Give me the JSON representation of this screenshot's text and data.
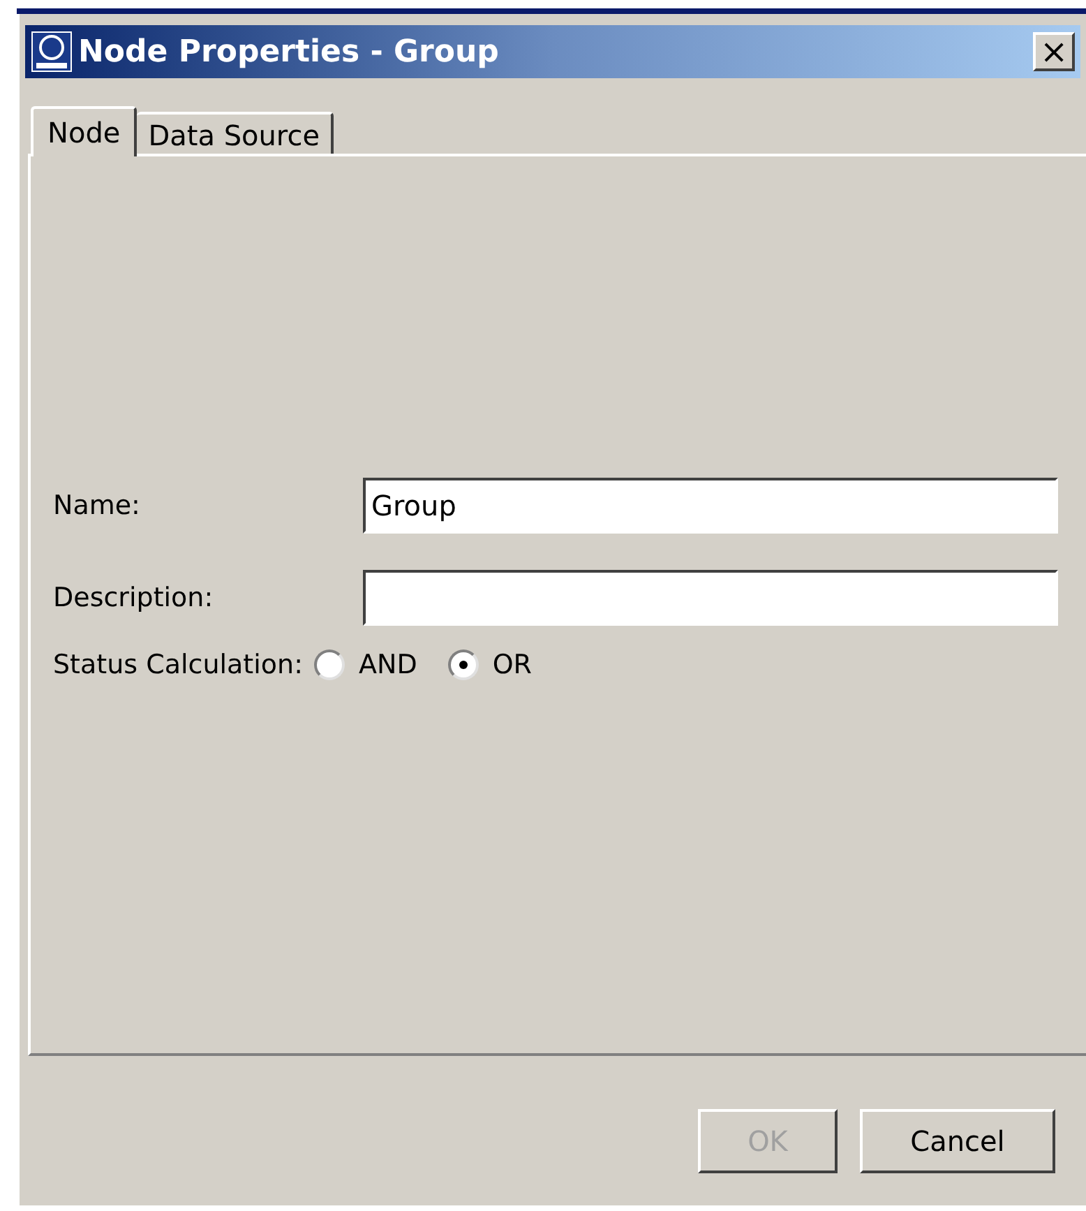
{
  "window": {
    "title": "Node Properties - Group",
    "close": "×"
  },
  "tabs": [
    {
      "label": "Node",
      "selected": true
    },
    {
      "label": "Data Source",
      "selected": false
    }
  ],
  "fields": [
    {
      "label": "Name:",
      "value": "Group"
    },
    {
      "label": "Description:"
    }
  ],
  "status_calculation": {
    "label": "Status Calculation:",
    "options": [
      {
        "label": "AND",
        "selected": false
      },
      {
        "label": "OR",
        "selected": true
      }
    ]
  },
  "buttons": [
    {
      "label": "OK",
      "disabled": true
    },
    {
      "label": "Cancel",
      "disabled": false
    }
  ]
}
